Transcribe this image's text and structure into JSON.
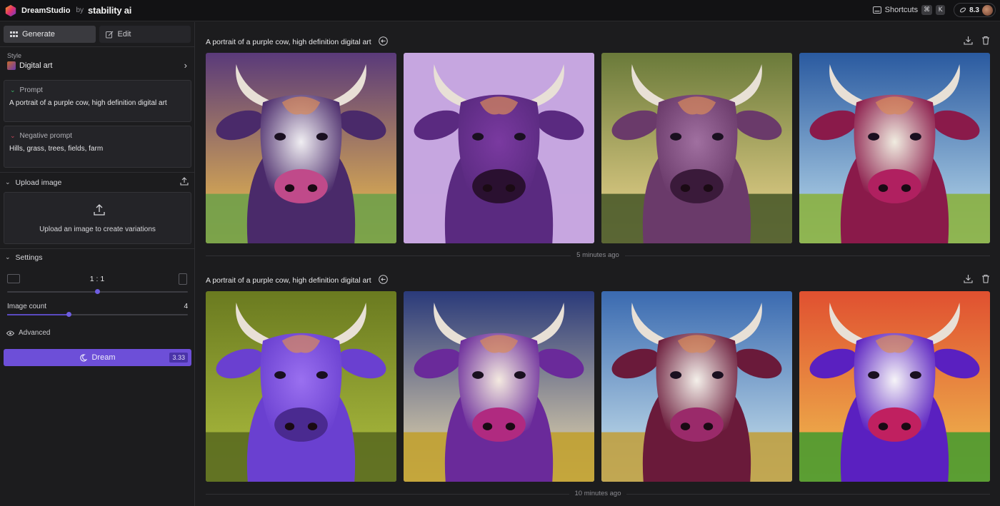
{
  "topbar": {
    "app_name": "DreamStudio",
    "by": "by",
    "brand": "stability ai",
    "shortcuts_label": "Shortcuts",
    "shortcut_keys": [
      "⌘",
      "K"
    ],
    "credits": "8.3"
  },
  "sidebar": {
    "tabs": [
      {
        "label": "Generate",
        "active": true
      },
      {
        "label": "Edit",
        "active": false
      }
    ],
    "style": {
      "title": "Style",
      "value": "Digital art"
    },
    "prompt": {
      "label": "Prompt",
      "value": "A portrait of a purple cow, high definition digital art"
    },
    "negative_prompt": {
      "label": "Negative prompt",
      "value": "Hills, grass, trees, fields, farm"
    },
    "upload": {
      "title": "Upload image",
      "hint": "Upload an image to create variations"
    },
    "settings": {
      "title": "Settings",
      "aspect_ratio": "1 : 1",
      "aspect_ratio_position": 0.5,
      "image_count_label": "Image count",
      "image_count": "4",
      "image_count_position": 0.34,
      "advanced_label": "Advanced"
    },
    "dream": {
      "label": "Dream",
      "cost": "3.33"
    }
  },
  "colors": {
    "accent": "#6d4fd8",
    "background": "#1c1c1e",
    "topbar": "#121214",
    "prompt_chevron": "#3dbb6b",
    "negative_chevron": "#d0455a"
  },
  "batches": [
    {
      "prompt": "A portrait of a purple cow, high definition digital art",
      "timestamp": "5 minutes ago",
      "images": [
        {
          "name": "cow-1-1",
          "sky": [
            "#5a3a7a",
            "#f3c24a"
          ],
          "ground": "#6fa04a",
          "body": "#4a2a6a",
          "face": "#f0eef2",
          "nose": "#c04a8a"
        },
        {
          "name": "cow-1-2",
          "sky": [
            "#c6a6e0",
            "#c6a6e0"
          ],
          "ground": "#c6a6e0",
          "body": "#5a2a80",
          "face": "#7a3aa0",
          "nose": "#2a1030"
        },
        {
          "name": "cow-1-3",
          "sky": [
            "#6a7a3a",
            "#f0d890"
          ],
          "ground": "#4a5a2a",
          "body": "#6a3a6a",
          "face": "#a070a0",
          "nose": "#3a1a3a"
        },
        {
          "name": "cow-1-4",
          "sky": [
            "#2a5aa0",
            "#c0e0f0"
          ],
          "ground": "#8ab040",
          "body": "#8a1a4a",
          "face": "#f0ece0",
          "nose": "#b02060"
        }
      ]
    },
    {
      "prompt": "A portrait of a purple cow, high definition digital art",
      "timestamp": "10 minutes ago",
      "images": [
        {
          "name": "cow-2-1",
          "sky": [
            "#6a7a20",
            "#b0c040"
          ],
          "ground": "#5a6a20",
          "body": "#6a40d0",
          "face": "#9a70f0",
          "nose": "#4a2a90"
        },
        {
          "name": "cow-2-2",
          "sky": [
            "#2a3a7a",
            "#f0e0b0"
          ],
          "ground": "#c0a030",
          "body": "#6a2a9a",
          "face": "#f4eae0",
          "nose": "#b02a80"
        },
        {
          "name": "cow-2-3",
          "sky": [
            "#3a6ab0",
            "#d0e8f0"
          ],
          "ground": "#c0a040",
          "body": "#6a1a3a",
          "face": "#f4f0ea",
          "nose": "#9a2a6a"
        },
        {
          "name": "cow-2-4",
          "sky": [
            "#e05030",
            "#f0c050"
          ],
          "ground": "#4a9a30",
          "body": "#5a20c0",
          "face": "#f6f4f8",
          "nose": "#c02060"
        }
      ]
    }
  ]
}
